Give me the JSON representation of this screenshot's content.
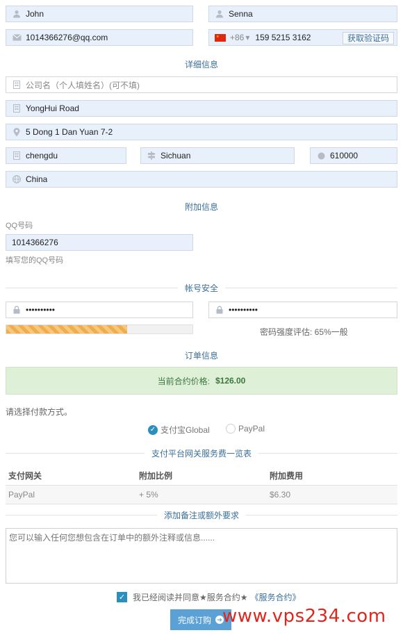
{
  "contact": {
    "first_name": "John",
    "last_name": "Senna",
    "email": "1014366276@qq.com",
    "phone_country_code": "+86",
    "phone_number": "159 5215 3162",
    "get_code_label": "获取验证码"
  },
  "details": {
    "section_title": "详细信息",
    "company_placeholder": "公司名（个人填姓名）(可不填)",
    "address1": "YongHui Road",
    "address2": "5 Dong 1 Dan Yuan 7-2",
    "city": "chengdu",
    "state": "Sichuan",
    "postcode": "610000",
    "country": "China"
  },
  "extra": {
    "section_title": "附加信息",
    "qq_label": "QQ号码",
    "qq_value": "1014366276",
    "qq_help": "填写您的QQ号码"
  },
  "security": {
    "section_title": "帐号安全",
    "password_mask": "••••••••••",
    "confirm_mask": "••••••••••",
    "strength_percent": 65,
    "strength_text": "密码强度评估: 65%一般"
  },
  "order": {
    "section_title": "订单信息",
    "price_label": "当前合约价格:",
    "price_value": "$126.00",
    "payment_prompt": "请选择付款方式。",
    "payment_options": [
      {
        "label": "支付宝Global",
        "selected": true
      },
      {
        "label": "PayPal",
        "selected": false
      }
    ]
  },
  "fees": {
    "section_title": "支付平台网关服务费一览表",
    "headers": [
      "支付网关",
      "附加比例",
      "附加费用"
    ],
    "rows": [
      [
        "PayPal",
        "+ 5%",
        "$6.30"
      ]
    ]
  },
  "notes": {
    "section_title": "添加备注或额外要求",
    "placeholder": "您可以输入任何您想包含在订单中的额外注释或信息......"
  },
  "agreement": {
    "text": "我已经阅读并同意★服务合约★",
    "link": "《服务合约》"
  },
  "submit_label": "完成订购",
  "watermark": "www.vps234.com",
  "colors": {
    "accent": "#2a8fbd",
    "field_bg": "#e8f0fb",
    "success_bg": "#dff0d8",
    "strength": "#f0ad4e",
    "watermark": "#e0261c"
  }
}
